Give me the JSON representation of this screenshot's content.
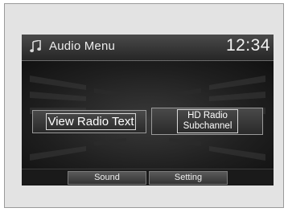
{
  "header": {
    "title": "Audio Menu",
    "clock": "12:34",
    "icon": "music-note-icon"
  },
  "buttons": {
    "view_radio_text": "View Radio Text",
    "hd_line1": "HD Radio",
    "hd_line2": "Subchannel"
  },
  "tabs": [
    {
      "label": "Sound"
    },
    {
      "label": "Setting"
    }
  ],
  "colors": {
    "screen_bg": "#141414",
    "frame_bg": "#e3e3e3"
  }
}
